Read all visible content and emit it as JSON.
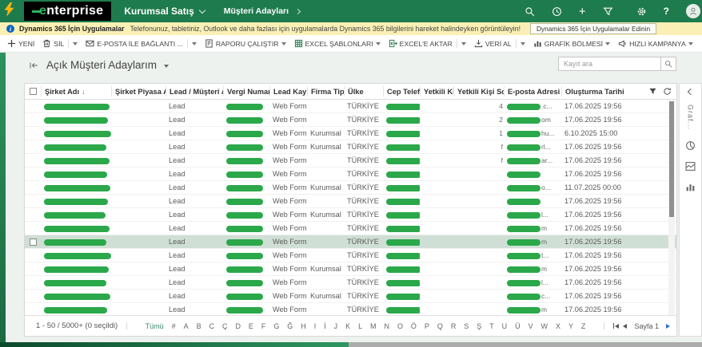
{
  "topbar": {
    "logo": "enterprise",
    "area": "Kurumsal Satış",
    "entity": "Müşteri Adayları"
  },
  "notice": {
    "title": "Dynamics 365 İçin Uygulamalar",
    "message": "Telefonunuz, tabletiniz, Outlook ve daha fazlası için uygulamalarda Dynamics 365 bilgilerini hareket halindeyken görüntüleyin!",
    "button": "Dynamics 365 İçin Uygulamalar Edinin"
  },
  "toolbar": {
    "buttons": [
      {
        "name": "new",
        "label": "YENİ",
        "icon": "plus-icon"
      },
      {
        "name": "delete",
        "label": "SİL",
        "icon": "trash-icon",
        "split": true
      },
      {
        "name": "email-link",
        "label": "E-POSTA İLE BAĞLANTI ...",
        "icon": "email-icon",
        "split": true
      },
      {
        "name": "run-report",
        "label": "RAPORU ÇALIŞTIR",
        "icon": "report-icon",
        "caret": true
      },
      {
        "name": "excel-templates",
        "label": "EXCEL ŞABLONLARI",
        "icon": "excel-template-icon",
        "caret": true
      },
      {
        "name": "export-excel",
        "label": "EXCEL'E AKTAR",
        "icon": "excel-export-icon",
        "split": true
      },
      {
        "name": "import-data",
        "label": "VERİ AL",
        "icon": "import-icon",
        "split": true
      },
      {
        "name": "chart-pane",
        "label": "GRAFİK BÖLMESİ",
        "icon": "bar-chart-icon",
        "caret": true
      },
      {
        "name": "quick-campaign",
        "label": "HIZLI KAMPANYA",
        "icon": "megaphone-icon",
        "caret": true
      },
      {
        "name": "more",
        "label": "",
        "icon": "ellipsis-icon"
      }
    ]
  },
  "view": {
    "title": "Açık Müşteri Adaylarım",
    "search_placeholder": "Kayıt ara"
  },
  "grid": {
    "columns": [
      "Şirket Adı",
      "Şirket Piyasa Adı",
      "Lead / Müşteri Adayı",
      "Vergi Numarası",
      "Lead Kaynağı...",
      "Firma Tipi",
      "Ülke",
      "Cep Telefonu...",
      "Yetkili Kişi Ad...",
      "Yetkili Kişi Soyad",
      "E-posta Adresi Şirket",
      "Oluşturma Tarihi"
    ],
    "sort": {
      "column": "Şirket Adı",
      "indicator": "↓"
    },
    "rows": [
      {
        "type": "Lead",
        "source": "Web Form",
        "firm_type": "",
        "country": "TÜRKİYE",
        "fragment": "4",
        "email_suffix": ".c...",
        "created": "17.06.2025 19:56",
        "bar": 82,
        "selected": false
      },
      {
        "type": "Lead",
        "source": "Web Form",
        "firm_type": "",
        "country": "TÜRKİYE",
        "fragment": "2",
        "email_suffix": "om",
        "created": "17.06.2025 19:56",
        "bar": 80,
        "selected": false
      },
      {
        "type": "Lead",
        "source": "Web Form",
        "firm_type": "Kurumsal",
        "country": "TÜRKİYE",
        "fragment": "1",
        "email_suffix": "hu...",
        "created": "6.10.2025 15:00",
        "bar": 84,
        "selected": false
      },
      {
        "type": "Lead",
        "source": "Web Form",
        "firm_type": "Kurumsal",
        "country": "TÜRKİYE",
        "fragment": "f",
        "email_suffix": "rl...",
        "created": "17.06.2025 19:56",
        "bar": 78,
        "selected": false
      },
      {
        "type": "Lead",
        "source": "Web Form",
        "firm_type": "",
        "country": "TÜRKİYE",
        "fragment": "f",
        "email_suffix": "ar...",
        "created": "17.06.2025 19:56",
        "bar": 82,
        "selected": false
      },
      {
        "type": "Lead",
        "source": "Web Form",
        "firm_type": "",
        "country": "TÜRKİYE",
        "fragment": "",
        "email_suffix": "",
        "created": "17.06.2025 19:56",
        "bar": 79,
        "selected": false
      },
      {
        "type": "Lead",
        "source": "Web Form",
        "firm_type": "Kurumsal",
        "country": "TÜRKİYE",
        "fragment": "",
        "email_suffix": "o...",
        "created": "11.07.2025 00:00",
        "bar": 83,
        "selected": false
      },
      {
        "type": "Lead",
        "source": "Web Form",
        "firm_type": "",
        "country": "TÜRKİYE",
        "fragment": "",
        "email_suffix": "",
        "created": "17.06.2025 19:56",
        "bar": 80,
        "selected": false
      },
      {
        "type": "Lead",
        "source": "Web Form",
        "firm_type": "Kurumsal",
        "country": "TÜRKİYE",
        "fragment": "",
        "email_suffix": "l...",
        "created": "17.06.2025 19:56",
        "bar": 77,
        "selected": false
      },
      {
        "type": "Lead",
        "source": "Web Form",
        "firm_type": "",
        "country": "TÜRKİYE",
        "fragment": "",
        "email_suffix": "m",
        "created": "17.06.2025 19:56",
        "bar": 82,
        "selected": false
      },
      {
        "type": "Lead",
        "source": "Web Form",
        "firm_type": "",
        "country": "TÜRKİYE",
        "fragment": "",
        "email_suffix": "m",
        "created": "17.06.2025 19:56",
        "bar": 78,
        "selected": true
      },
      {
        "type": "Lead",
        "source": "Web Form",
        "firm_type": "",
        "country": "TÜRKİYE",
        "fragment": "",
        "email_suffix": "t...",
        "created": "17.06.2025 19:56",
        "bar": 84,
        "selected": false
      },
      {
        "type": "Lead",
        "source": "Web Form",
        "firm_type": "Kurumsal",
        "country": "TÜRKİYE",
        "fragment": "",
        "email_suffix": "m",
        "created": "17.06.2025 19:56",
        "bar": 81,
        "selected": false
      },
      {
        "type": "Lead",
        "source": "Web Form",
        "firm_type": "",
        "country": "TÜRKİYE",
        "fragment": "",
        "email_suffix": "l...",
        "created": "17.06.2025 19:56",
        "bar": 78,
        "selected": false
      },
      {
        "type": "Lead",
        "source": "Web Form",
        "firm_type": "Kurumsal",
        "country": "TÜRKİYE",
        "fragment": "",
        "email_suffix": "c...",
        "created": "17.06.2025 19:56",
        "bar": 83,
        "selected": false
      },
      {
        "type": "Lead",
        "source": "Web Form",
        "firm_type": "",
        "country": "TÜRKİYE",
        "fragment": "",
        "email_suffix": "m",
        "created": "17.06.2025 19:56",
        "bar": 79,
        "selected": false
      }
    ]
  },
  "statusbar": {
    "range": "1 - 50  / 5000+ (0 seçildi)",
    "jump": [
      "Tümü",
      "#",
      "A",
      "B",
      "C",
      "Ç",
      "D",
      "E",
      "F",
      "G",
      "Ğ",
      "H",
      "I",
      "İ",
      "J",
      "K",
      "L",
      "M",
      "N",
      "O",
      "Ö",
      "P",
      "Q",
      "R",
      "S",
      "Ş",
      "T",
      "U",
      "Ü",
      "V",
      "W",
      "X",
      "Y",
      "Z"
    ],
    "page": "Sayfa 1"
  },
  "side_panel": {
    "label": "Graf..."
  },
  "colors": {
    "brand_green": "#1E7B4D",
    "logo_green": "#2DB55D",
    "pill_green": "#2BA84A",
    "selected_row": "#D0DFD6",
    "notice_bg": "#FAF0B5",
    "next_page_blue": "#2F6FDE"
  }
}
